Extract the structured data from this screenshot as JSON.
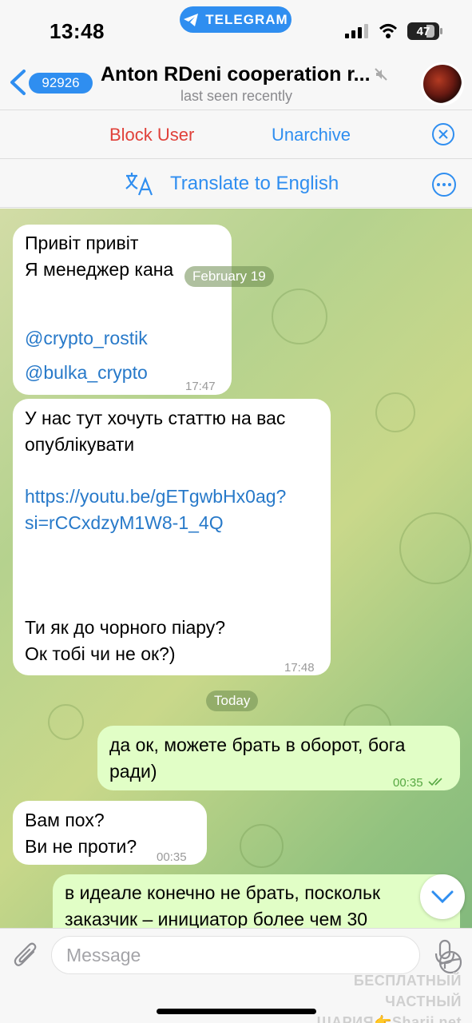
{
  "status": {
    "time": "13:48",
    "app_pill": "TELEGRAM",
    "battery": "47"
  },
  "header": {
    "unread_count": "92926",
    "title": "Anton RDeni cooperation r...",
    "subtitle": "last seen recently"
  },
  "actions": {
    "block": "Block User",
    "unarchive": "Unarchive"
  },
  "translate": {
    "label": "Translate to English"
  },
  "messages": [
    {
      "dir": "in",
      "lines": [
        "Привіт привіт",
        "Я менеджер кана"
      ],
      "links": [
        "@crypto_rostik",
        "@bulka_crypto"
      ],
      "time": "17:47"
    },
    {
      "dir": "in",
      "text1": "У нас тут хочуть статтю на вас\nопублікувати",
      "link": "https://youtu.be/gETgwbHx0ag?\nsi=rCCxdzyM1W8-1_4Q",
      "text2": "Ти як до чорного піару?\nОк тобі чи не ок?)",
      "time": "17:48"
    },
    {
      "dir": "out",
      "text": "да ок, можете брать в оборот, бога\nради)",
      "time": "00:35"
    },
    {
      "dir": "in",
      "text": "Вам пох?\nВи не проти?",
      "time": "00:35"
    },
    {
      "dir": "out",
      "text": "в идеале конечно не брать, поскольк\nзаказчик – инициатор более чем 30"
    }
  ],
  "dates": {
    "first": "February 19",
    "today": "Today"
  },
  "input": {
    "placeholder": "Message"
  },
  "watermark": {
    "line1": "БЕСПЛАТНЫЙ ЧАСТНЫЙ",
    "line2": "ШАРИЯ👉Sharij.net"
  },
  "colors": {
    "accent": "#2f8ef0",
    "danger": "#e0413a",
    "outgoing_bubble": "#e1fec6"
  }
}
